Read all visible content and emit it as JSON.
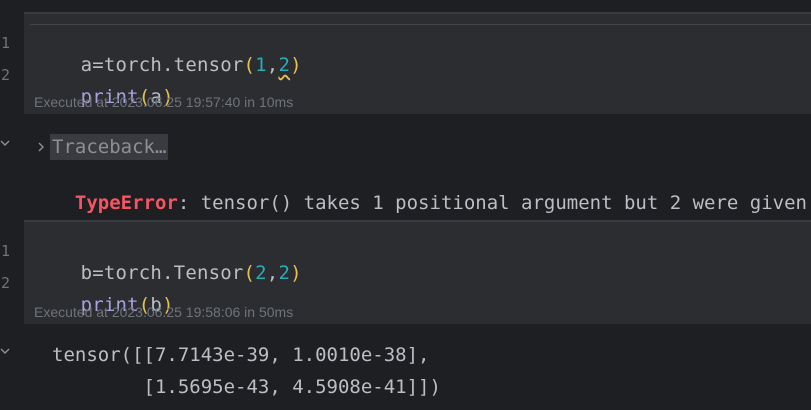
{
  "cells": [
    {
      "line_numbers": [
        "1",
        "2"
      ],
      "code": {
        "line1": {
          "var": "a=torch.tensor",
          "open": "(",
          "arg1": "1",
          "comma": ",",
          "arg2": "2",
          "close": ")"
        },
        "line2": {
          "fn": "print",
          "open": "(",
          "arg": "a",
          "close": ")"
        }
      },
      "executed": "Executed at 2023.06.25 19:57:40 in 10ms"
    },
    {
      "line_numbers": [
        "1",
        "2"
      ],
      "code": {
        "line1": {
          "var": "b=torch.Tensor",
          "open": "(",
          "arg1": "2",
          "comma": ",",
          "arg2": "2",
          "close": ")"
        },
        "line2": {
          "fn": "print",
          "open": "(",
          "arg": "b",
          "close": ")"
        }
      },
      "executed": "Executed at 2023.06.25 19:58:06 in 50ms"
    }
  ],
  "outputs": [
    {
      "traceback_label": "Traceback…",
      "error_type": "TypeError",
      "error_message": ": tensor() takes 1 positional argument but 2 were given"
    },
    {
      "lines": [
        "tensor([[7.7143e-39, 1.0010e-38],",
        "        [1.5695e-43, 4.5908e-41]])"
      ]
    }
  ],
  "icons": {
    "collapse": "chevron-down-icon",
    "expand": "chevron-right-icon"
  }
}
